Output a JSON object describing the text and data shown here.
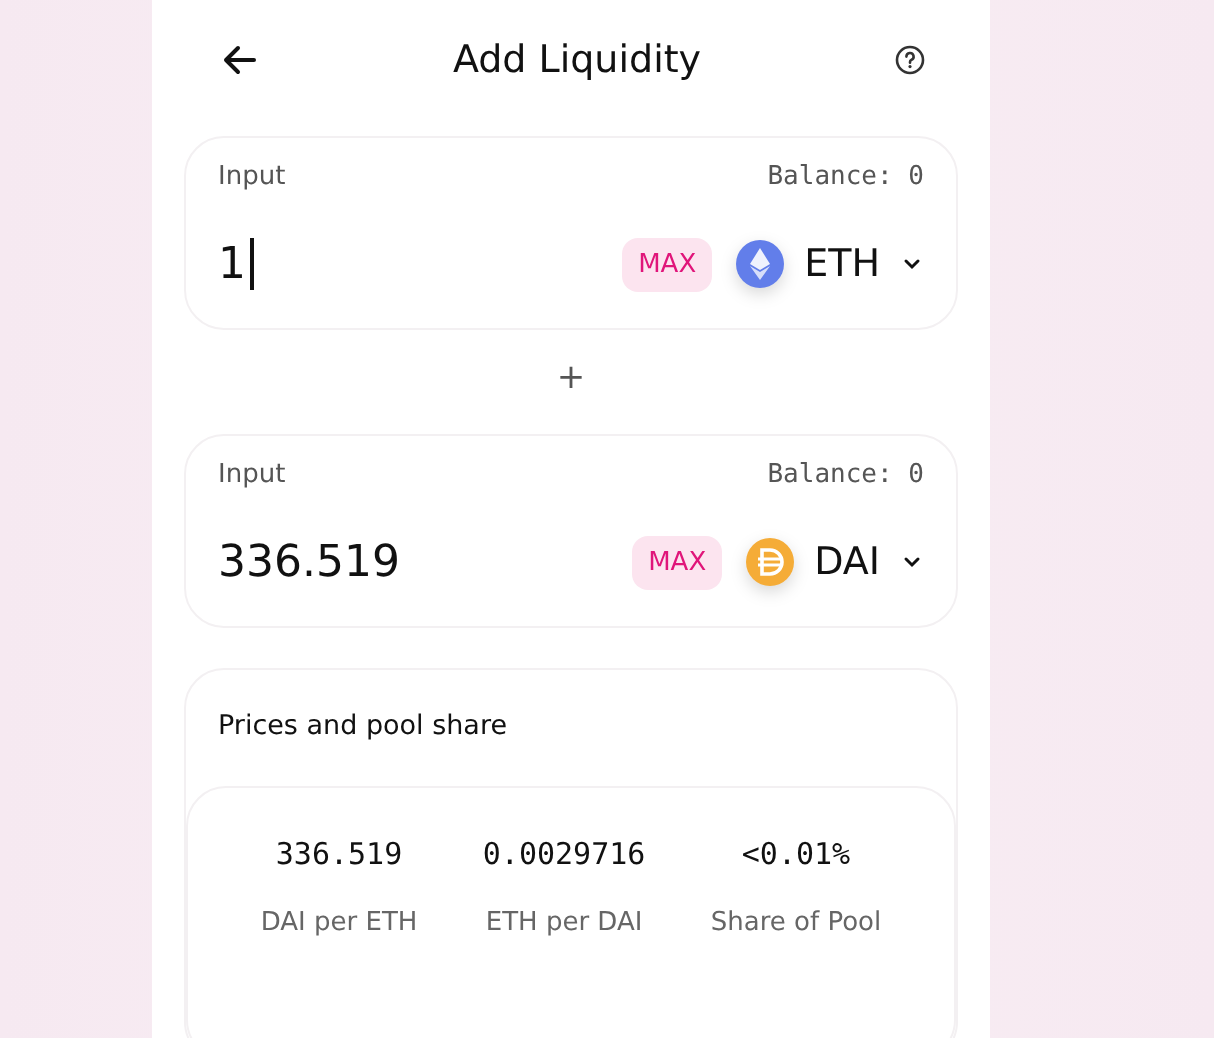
{
  "header": {
    "title": "Add Liquidity"
  },
  "inputs": [
    {
      "label": "Input",
      "balance": "Balance: 0",
      "value": "1",
      "focused": true,
      "max": "MAX",
      "token": {
        "kind": "eth",
        "symbol": "ETH"
      }
    },
    {
      "label": "Input",
      "balance": "Balance: 0",
      "value": "336.519",
      "focused": false,
      "max": "MAX",
      "token": {
        "kind": "dai",
        "symbol": "DAI"
      }
    }
  ],
  "plus": "+",
  "prices": {
    "title": "Prices and pool share",
    "stats": [
      {
        "value": "336.519",
        "label": "DAI per ETH"
      },
      {
        "value": "0.0029716",
        "label": "ETH per DAI"
      },
      {
        "value": "<0.01%",
        "label": "Share of Pool"
      }
    ]
  }
}
